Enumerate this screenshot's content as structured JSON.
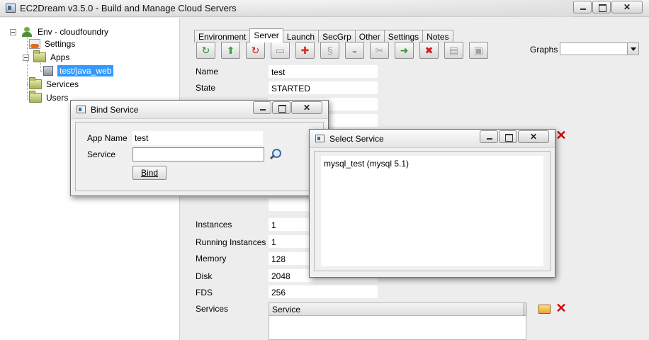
{
  "window": {
    "title": "EC2Dream v3.5.0 - Build and Manage Cloud Servers",
    "minimize": "",
    "maximize": "",
    "close": "✕"
  },
  "tree": {
    "root": "Env - cloudfoundry",
    "settings": "Settings",
    "apps": "Apps",
    "app_selected": "test/java_web",
    "services": "Services",
    "users": "Users"
  },
  "tabs": [
    "Environment",
    "Server",
    "Launch",
    "SecGrp",
    "Other",
    "Settings",
    "Notes"
  ],
  "active_tab": "Server",
  "toolbar": [
    {
      "icon": "refresh-icon",
      "glyph": "↻",
      "color": "#2f8a2f"
    },
    {
      "icon": "upload-icon",
      "glyph": "⬆",
      "color": "#3aa33a"
    },
    {
      "icon": "restart-icon",
      "glyph": "↻",
      "color": "#d02020"
    },
    {
      "icon": "server-icon",
      "glyph": "▭",
      "color": "#9a9a9a"
    },
    {
      "icon": "connect-icon",
      "glyph": "✚",
      "color": "#d8341c"
    },
    {
      "icon": "script-icon",
      "glyph": "§",
      "color": "#a0a0a0"
    },
    {
      "icon": "disk-icon",
      "glyph": "◒",
      "color": "#a0a0a0"
    },
    {
      "icon": "tools-icon",
      "glyph": "✂",
      "color": "#a0a0a0"
    },
    {
      "icon": "forward-arrow-icon",
      "glyph": "➜",
      "color": "#2f9a2f"
    },
    {
      "icon": "stop-icon",
      "glyph": "✖",
      "color": "#d42020"
    },
    {
      "icon": "chart-icon",
      "glyph": "▤",
      "color": "#a0a0a0"
    },
    {
      "icon": "log-icon",
      "glyph": "▣",
      "color": "#a0a0a0"
    }
  ],
  "graphs": {
    "label": "Graphs",
    "value": ""
  },
  "fields": {
    "name_label": "Name",
    "name_value": "test",
    "state_label": "State",
    "state_value": "STARTED",
    "instances_label": "Instances",
    "instances_value": "1",
    "running_label": "Running Instances",
    "running_value": "1",
    "memory_label": "Memory",
    "memory_value": "128",
    "disk_label": "Disk",
    "disk_value": "2048",
    "fds_label": "FDS",
    "fds_value": "256",
    "services_label": "Services",
    "services_header": "Service"
  },
  "bind_dialog": {
    "title": "Bind Service",
    "app_name_label": "App Name",
    "app_name_value": "test",
    "service_label": "Service",
    "service_value": "",
    "bind_button": "Bind"
  },
  "select_dialog": {
    "title": "Select Service",
    "items": [
      "mysql_test (mysql 5.1)"
    ]
  },
  "colors": {
    "selection": "#3399ff",
    "delete": "#d40000"
  }
}
